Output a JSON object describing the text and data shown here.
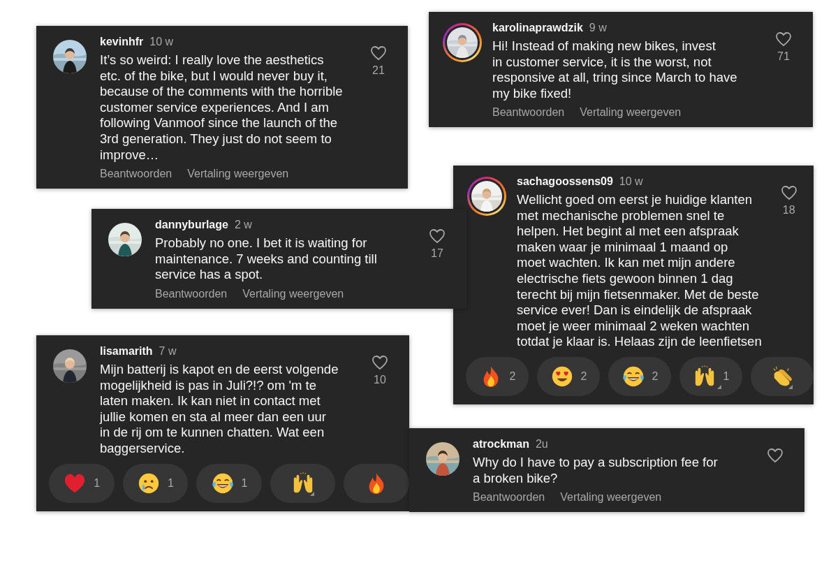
{
  "comments": [
    {
      "username": "kevinhfr",
      "time": "10 w",
      "story_ring": false,
      "avatar": {
        "kind": "picture"
      },
      "text": "It’s so weird: I really love the aesthetics\netc. of the bike, but I would never buy it,\nbecause of the comments with the horrible\ncustomer service experiences. And I am\nfollowing Vanmoof since the launch of the\n3rd generation. They just do not seem to\nimprove…",
      "likes": "21",
      "actions": [
        "Beantwoorden",
        "Vertaling weergeven"
      ]
    },
    {
      "username": "karolinaprawdzik",
      "time": "9 w",
      "story_ring": true,
      "avatar": {
        "kind": "picture"
      },
      "text": "Hi! Instead of making new bikes, invest\nin customer service, it is the worst, not\nresponsive at all, tring since March to have\nmy bike fixed!",
      "likes": "71",
      "actions": [
        "Beantwoorden",
        "Vertaling weergeven"
      ]
    },
    {
      "username": "dannyburlage",
      "time": "2 w",
      "story_ring": false,
      "avatar": {
        "kind": "picture"
      },
      "text": "Probably no one. I bet it is waiting for\nmaintenance. 7 weeks and counting till\nservice has a spot.",
      "likes": "17",
      "actions": [
        "Beantwoorden",
        "Vertaling weergeven"
      ]
    },
    {
      "username": "sachagoossens09",
      "time": "10 w",
      "story_ring": true,
      "avatar": {
        "kind": "picture"
      },
      "text": "Wellicht goed om eerst je huidige klanten\nmet mechanische problemen snel te\nhelpen. Het begint al met een afspraak\nmaken waar je minimaal 1 maand op\nmoet wachten. Ik kan met mijn andere\nelectrische fiets gewoon binnen 1 dag\nterecht bij mijn fietsenmaker. Met de beste\nservice ever! Dan is eindelijk de afspraak\nmoet je weer minimaal 2 weken wachten\ntotdat je klaar is. Helaas zijn de leenfietsen",
      "likes": "18",
      "reactions": [
        {
          "kind": "fire",
          "count": "2",
          "corner_mark": false
        },
        {
          "kind": "heart-eyes",
          "count": "2",
          "corner_mark": false
        },
        {
          "kind": "joy",
          "count": "2",
          "corner_mark": false
        },
        {
          "kind": "raised-hands",
          "count": "1",
          "corner_mark": true
        },
        {
          "kind": "clap",
          "corner_mark": true
        }
      ]
    },
    {
      "username": "lisamarith",
      "time": "7 w",
      "story_ring": false,
      "avatar": {
        "kind": "picture"
      },
      "text": "Mijn batterij is kapot en de eerst volgende\nmogelijkheid is pas in Juli?!? om 'm te\nlaten maken. Ik kan niet in contact met\njullie komen en sta al meer dan een uur\nin de rij om te kunnen chatten. Wat een\nbaggerservice.",
      "likes": "10",
      "reactions": [
        {
          "kind": "heart",
          "count": "1",
          "corner_mark": false
        },
        {
          "kind": "crying",
          "count": "1",
          "corner_mark": false
        },
        {
          "kind": "joy",
          "count": "1",
          "corner_mark": false
        },
        {
          "kind": "raised-hands",
          "corner_mark": true
        },
        {
          "kind": "fire",
          "corner_mark": false
        }
      ]
    },
    {
      "username": "atrockman",
      "time": "2u",
      "story_ring": false,
      "avatar": {
        "kind": "picture"
      },
      "text": "Why do I have to pay a subscription fee for\na broken bike?",
      "actions": [
        "Beantwoorden",
        "Vertaling weergeven"
      ]
    }
  ]
}
